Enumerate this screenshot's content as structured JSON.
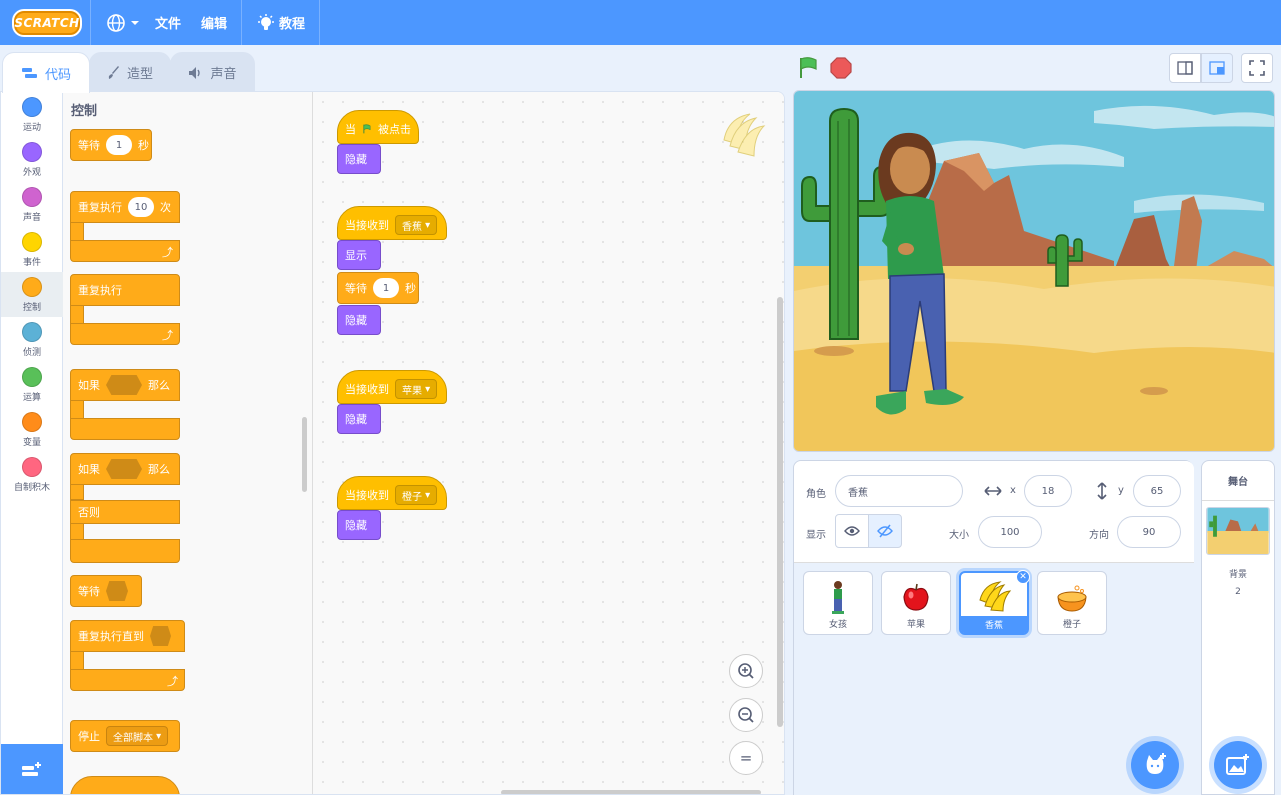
{
  "menubar": {
    "logo": "SCRATCH",
    "file": "文件",
    "edit": "编辑",
    "tutorials": "教程"
  },
  "tabs": {
    "code": "代码",
    "costumes": "造型",
    "sounds": "声音"
  },
  "categories": [
    {
      "label": "运动",
      "color": "#4c97ff"
    },
    {
      "label": "外观",
      "color": "#9966ff"
    },
    {
      "label": "声音",
      "color": "#cf63cf"
    },
    {
      "label": "事件",
      "color": "#ffd500"
    },
    {
      "label": "控制",
      "color": "#ffab19"
    },
    {
      "label": "侦测",
      "color": "#5cb1d6"
    },
    {
      "label": "运算",
      "color": "#59c059"
    },
    {
      "label": "变量",
      "color": "#ff8c1a"
    },
    {
      "label": "自制积木",
      "color": "#ff6680"
    }
  ],
  "palette": {
    "title": "控制",
    "wait": "等待",
    "wait_val": "1",
    "wait_unit": "秒",
    "repeat": "重复执行",
    "repeat_val": "10",
    "repeat_unit": "次",
    "forever": "重复执行",
    "if": "如果",
    "then": "那么",
    "if2": "如果",
    "then2": "那么",
    "else": "否则",
    "wait_until": "等待",
    "repeat_until": "重复执行直到",
    "stop": "停止",
    "stop_opt": "全部脚本"
  },
  "scripts": {
    "s1_when": "当",
    "s1_clicked": "被点击",
    "s1_hide": "隐藏",
    "s2_recv": "当接收到",
    "s2_msg": "香蕉",
    "s2_show": "显示",
    "s2_wait": "等待",
    "s2_wait_val": "1",
    "s2_wait_unit": "秒",
    "s2_hide": "隐藏",
    "s3_recv": "当接收到",
    "s3_msg": "苹果",
    "s3_hide": "隐藏",
    "s4_recv": "当接收到",
    "s4_msg": "橙子",
    "s4_hide": "隐藏"
  },
  "zoom": {
    "in": "+",
    "out": "−",
    "reset": "="
  },
  "sprite_info": {
    "sprite_label": "角色",
    "sprite_name": "香蕉",
    "x_label": "x",
    "x": "18",
    "y_label": "y",
    "y": "65",
    "show_label": "显示",
    "size_label": "大小",
    "size": "100",
    "direction_label": "方向",
    "direction": "90"
  },
  "sprites": [
    {
      "name": "女孩"
    },
    {
      "name": "苹果"
    },
    {
      "name": "香蕉"
    },
    {
      "name": "橙子"
    }
  ],
  "stage_panel": {
    "title": "舞台",
    "backdrops_label": "背景",
    "backdrops_count": "2"
  },
  "colors": {
    "accent": "#4c97ff",
    "control": "#ffab19",
    "events": "#ffbf00",
    "looks": "#9966ff"
  }
}
